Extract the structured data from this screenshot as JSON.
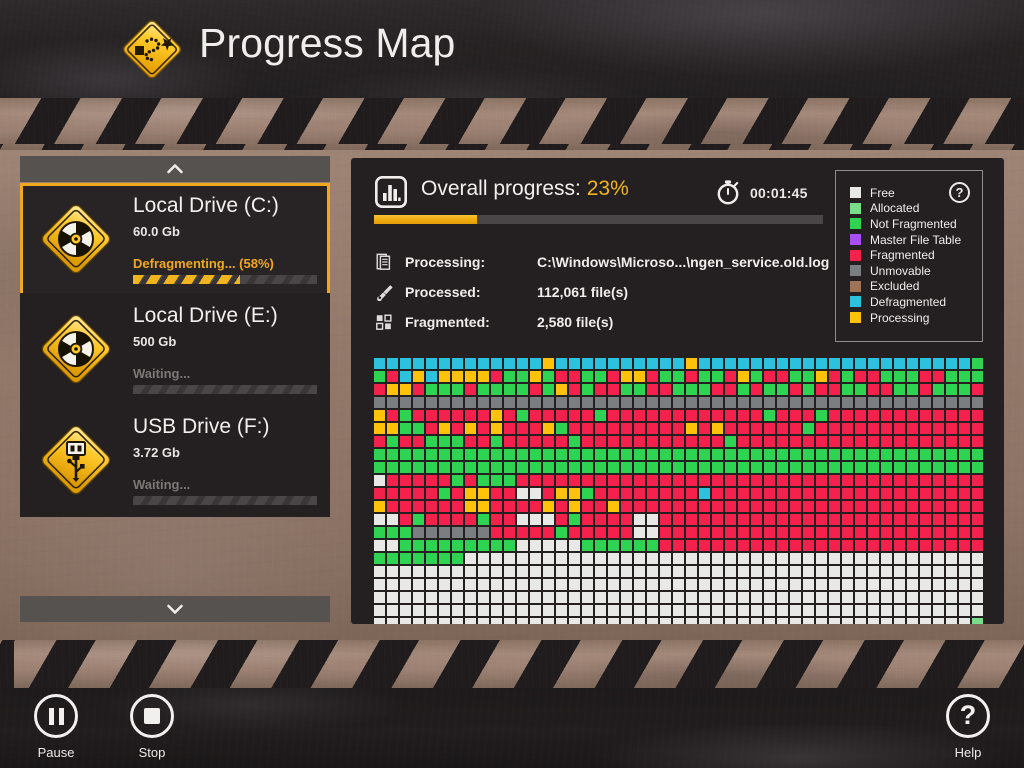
{
  "window": {
    "title": "Progress Map",
    "logo_icon": "road-sign-defrag-icon"
  },
  "sidebar": {
    "scroll_up_icon": "chevron-up-icon",
    "scroll_down_icon": "chevron-down-icon",
    "drives": [
      {
        "name": "Local Drive (C:)",
        "size": "60.0 Gb",
        "status": "Defragmenting... (58%)",
        "progress": 58,
        "selected": true,
        "icon": "disk-drive-icon"
      },
      {
        "name": "Local Drive (E:)",
        "size": "500 Gb",
        "status": "Waiting...",
        "progress": 0,
        "selected": false,
        "icon": "disk-drive-icon"
      },
      {
        "name": "USB Drive (F:)",
        "size": "3.72 Gb",
        "status": "Waiting...",
        "progress": 0,
        "selected": false,
        "icon": "usb-drive-icon"
      }
    ]
  },
  "panel": {
    "operation_icon": "bar-chart-icon",
    "operation_label": "Overall progress:",
    "operation_percent": "23%",
    "overall_progress": 23,
    "timer_icon": "stopwatch-icon",
    "elapsed": "00:01:45",
    "stats": [
      {
        "icon": "document-icon",
        "key": "Processing:",
        "value": "C:\\Windows\\Microso...\\ngen_service.old.log"
      },
      {
        "icon": "wrench-icon",
        "key": "Processed:",
        "value": "112,061 file(s)"
      },
      {
        "icon": "blocks-icon",
        "key": "Fragmented:",
        "value": "2,580 file(s)"
      }
    ],
    "legend": {
      "help_icon": "question-mark-icon",
      "help_label": "?",
      "items": [
        {
          "label": "Free",
          "color": "#e8e8e6"
        },
        {
          "label": "Allocated",
          "color": "#79dd8c"
        },
        {
          "label": "Not Fragmented",
          "color": "#2fd352"
        },
        {
          "label": "Master File Table",
          "color": "#a74ff2"
        },
        {
          "label": "Fragmented",
          "color": "#f4214d"
        },
        {
          "label": "Unmovable",
          "color": "#7b7e80"
        },
        {
          "label": "Excluded",
          "color": "#9e7459"
        },
        {
          "label": "Defragmented",
          "color": "#2cc2dd"
        },
        {
          "label": "Processing",
          "color": "#ffc20a"
        }
      ]
    }
  },
  "cluster_map": {
    "columns": 47,
    "rows": 21,
    "palette": {
      "F": "#e8e8e6",
      "A": "#79dd8c",
      "N": "#2fd352",
      "M": "#a74ff2",
      "G": "#f4214d",
      "U": "#7b7e80",
      "X": "#9e7459",
      "D": "#2cc2dd",
      "P": "#ffc20a"
    },
    "rows_data": [
      "DDDDDDDDDDDDDPDDDDDDDDDDPDDDDDDDDDDDDDDDDDDDDDN",
      "NGDPDPPPPGNNPNGGNNGPPGNNGNNGPNGGNNPGNGGNNNGGNNNG",
      "GPPGNNNGNNNNGNPGNGGNNGGNNNGGNGNNGNGGNNGGNNGNNNGG",
      "UUUUUUUUUUUUUUUUUUUUUUUUUUUUUUUUUUUUUUUUUUUUUUU",
      "PGNGGGGGGPGNGGGGGNGGGGGGGGGGGGNGGGNGGGGGGGGGGGG",
      "PPNNGPGPGPGGGPNGGGGGGGGGPGPGGGGGGNGGGGGGGGGGGGG",
      "GNGGNNNGGNGGGGGNGGGGGGGGGGGNGGGGGGGGGGGGGGGGGGG",
      "NNNNNNNNNNNNNNNNNNNNNNNNNNNNNNNNNNNNNNNNNNNNNNN",
      "NNNNNNNNNNNNNNNNNNNNNNNNNNNNNNNNNNNNNNNNNNNNNNN",
      "FGGGGGNGNNNGGGGGGGGGGGGGGGGGGGGGGGGGGGGGGGGGGGG",
      "GGGGGNGPPGGFFGPPNGGGGGGGGDGGGGGGGGGGGGGGGGGGGGG",
      "PGGGGGGPPGGGGPGPGGPGGGGGGGGGGGGGGGGGGGGGGGGGGGG",
      "FFGNGGGGNGGFFFGNGGGGFFGGGGGGGGGGGGGGGGGGGGGGGGG",
      "NNNUUUUUUGGGGGNGGGGGFFGGGGGGGGGGGGGGGGGGGGGGGGG",
      "FFNNNNNNNNNFFFFFNNNNNNGGGGGGGGGGGGGGGGGGGGGGGGG",
      "NNNNNNNFFFFFFFFFFFFFFFFFFFFFFFFFFFFFFFFFFFFFFFF",
      "FFFFFFFFFFFFFFFFFFFFFFFFFFFFFFFFFFFFFFFFFFFFFFF",
      "FFFFFFFFFFFFFFFFFFFFFFFFFFFFFFFFFFFFFFFFFFFFFFF",
      "FFFFFFFFFFFFFFFFFFFFFFFFFFFFFFFFFFFFFFFFFFFFFFF",
      "FFFFFFFFFFFFFFFFFFFFFFFFFFFFFFFFFFFFFFFFFFFFFFF",
      "FFFFFFFFFFFFFFFFFFFFFFFFFFFFFFFFFFFFFFFFFFFFFFA"
    ]
  },
  "footer": {
    "buttons": [
      {
        "label": "Pause",
        "icon": "pause-icon"
      },
      {
        "label": "Stop",
        "icon": "stop-icon"
      }
    ],
    "help": {
      "label": "Help",
      "icon": "question-mark-icon"
    }
  }
}
